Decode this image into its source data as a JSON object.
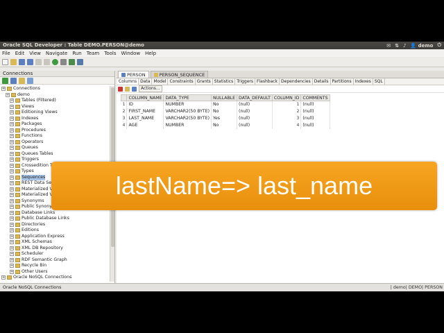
{
  "window": {
    "title": "Oracle SQL Developer : Table DEMO.PERSON@demo",
    "user": "demo"
  },
  "menu": [
    "File",
    "Edit",
    "View",
    "Navigate",
    "Run",
    "Team",
    "Tools",
    "Window",
    "Help"
  ],
  "connections_panel": {
    "title": "Connections",
    "tree": [
      {
        "label": "Connections",
        "level": 0
      },
      {
        "label": "demo",
        "level": 1
      },
      {
        "label": "Tables (Filtered)",
        "level": 2
      },
      {
        "label": "Views",
        "level": 2
      },
      {
        "label": "Editioning Views",
        "level": 2
      },
      {
        "label": "Indexes",
        "level": 2
      },
      {
        "label": "Packages",
        "level": 2
      },
      {
        "label": "Procedures",
        "level": 2
      },
      {
        "label": "Functions",
        "level": 2
      },
      {
        "label": "Operators",
        "level": 2
      },
      {
        "label": "Queues",
        "level": 2
      },
      {
        "label": "Queues Tables",
        "level": 2
      },
      {
        "label": "Triggers",
        "level": 2
      },
      {
        "label": "Crossedition T",
        "level": 2
      },
      {
        "label": "Types",
        "level": 2
      },
      {
        "label": "Sequences",
        "level": 2,
        "selected": true
      },
      {
        "label": "REST Data Ser",
        "level": 2
      },
      {
        "label": "Materialized Vi",
        "level": 2
      },
      {
        "label": "Materialized Vi",
        "level": 2
      },
      {
        "label": "Synonyms",
        "level": 2
      },
      {
        "label": "Public Synonym",
        "level": 2
      },
      {
        "label": "Database Links",
        "level": 2
      },
      {
        "label": "Public Database Links",
        "level": 2
      },
      {
        "label": "Directories",
        "level": 2
      },
      {
        "label": "Editions",
        "level": 2
      },
      {
        "label": "Application Express",
        "level": 2
      },
      {
        "label": "XML Schemas",
        "level": 2
      },
      {
        "label": "XML DB Repository",
        "level": 2
      },
      {
        "label": "Scheduler",
        "level": 2
      },
      {
        "label": "RDF Semantic Graph",
        "level": 2
      },
      {
        "label": "Recycle Bin",
        "level": 2
      },
      {
        "label": "Other Users",
        "level": 2
      },
      {
        "label": "Oracle NoSQL Connections",
        "level": 0
      }
    ]
  },
  "editor": {
    "doc_tabs": [
      {
        "label": "PERSON",
        "active": true
      },
      {
        "label": "PERSON_SEQUENCE",
        "active": false
      }
    ],
    "sub_tabs": [
      "Columns",
      "Data",
      "Model",
      "Constraints",
      "Grants",
      "Statistics",
      "Triggers",
      "Flashback",
      "Dependencies",
      "Details",
      "Partitions",
      "Indexes",
      "SQL"
    ],
    "actions_label": "Actions...",
    "columns_header": [
      "",
      "COLUMN_NAME",
      "DATA_TYPE",
      "NULLABLE",
      "DATA_DEFAULT",
      "COLUMN_ID",
      "COMMENTS"
    ],
    "rows": [
      [
        "1",
        "ID",
        "NUMBER",
        "No",
        "(null)",
        "1",
        "(null)"
      ],
      [
        "2",
        "FIRST_NAME",
        "VARCHAR2(50 BYTE)",
        "No",
        "(null)",
        "2",
        "(null)"
      ],
      [
        "3",
        "LAST_NAME",
        "VARCHAR2(50 BYTE)",
        "Yes",
        "(null)",
        "3",
        "(null)"
      ],
      [
        "4",
        "AGE",
        "NUMBER",
        "No",
        "(null)",
        "4",
        "(null)"
      ]
    ]
  },
  "status": {
    "left": "Oracle NoSQL Connections",
    "right": "| demo| DEMO| PERSON"
  },
  "caption": "lastName=> last_name"
}
